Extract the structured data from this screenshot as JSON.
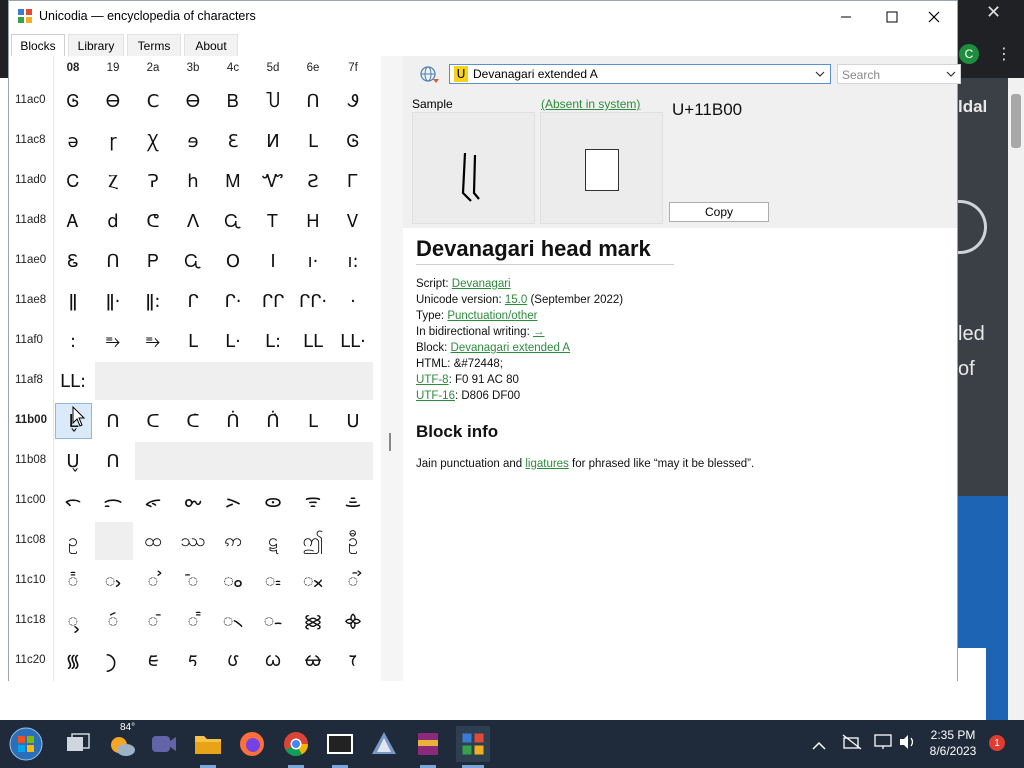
{
  "window": {
    "title": "Unicodia — encyclopedia of characters"
  },
  "tabs": [
    {
      "label": "Blocks",
      "active": true
    },
    {
      "label": "Library",
      "active": false
    },
    {
      "label": "Terms",
      "active": false
    },
    {
      "label": "About",
      "active": false
    }
  ],
  "grid": {
    "columns": [
      "08",
      "19",
      "2a",
      "3b",
      "4c",
      "5d",
      "6e",
      "7f"
    ],
    "rows": [
      {
        "label": "11ac0",
        "chars": [
          "Ꮆ",
          "Ꮎ",
          "Ⅽ",
          "Ꮎ",
          "Ᏼ",
          "Ⴎ",
          "Ո",
          "Ꮽ"
        ]
      },
      {
        "label": "11ac8",
        "chars": [
          "ә",
          "ɼ",
          "Ꭓ",
          "ɘ",
          "Ɛ",
          "И",
          "Ⅼ",
          "Ꮆ"
        ]
      },
      {
        "label": "11ad0",
        "chars": [
          "Ꮯ",
          "Ⲍ",
          "Ɂ",
          "h",
          "Ꮇ",
          "Ꮙ",
          "Ƨ",
          "Ꮁ"
        ]
      },
      {
        "label": "11ad8",
        "chars": [
          "Ꭺ",
          "d",
          "ᕦ",
          "Λ",
          "Ꮹ",
          "Ꭲ",
          "Ꮋ",
          "Ꮩ"
        ]
      },
      {
        "label": "11ae0",
        "chars": [
          "Ꮛ",
          "Ո",
          "Ꮲ",
          "Ꮹ",
          "O",
          "I",
          "ı·",
          "ı:"
        ]
      },
      {
        "label": "11ae8",
        "chars": [
          "ǁ",
          "ǁ·",
          "ǁ:",
          "ᒋ",
          "ᒋ·",
          "ᒋᒋ",
          "ᒋᒋ·",
          "·"
        ]
      },
      {
        "label": "11af0",
        "chars": [
          ":",
          "⥱",
          "⥱",
          "ᒪ",
          "ᒪ·",
          "ᒪ:",
          "ᒪᒪ",
          "ᒪᒪ·"
        ]
      }
    ],
    "row_11af8": {
      "label": "11af8",
      "char": "ᒪᒪ:"
    },
    "row_11b00": {
      "label": "11b00",
      "chars": [
        "ᒪ̬",
        "ᑎ",
        "ᑕ",
        "ᑕ̇",
        "ᑏ",
        "ᑏ̇",
        "ᒪ",
        "ᑌ"
      ]
    },
    "row_11b08": {
      "label": "11b08",
      "chars": [
        "ᑌ̬",
        "ᑎ"
      ]
    },
    "row_11c08": {
      "label": "11c08",
      "chars": [
        "ဥ",
        "ထ",
        "ဿ",
        "ဢ",
        "ဋ",
        "ဤ",
        "ဦ"
      ]
    },
    "rows_tail": [
      {
        "label": "11c00",
        "chars": [
          "ᯞ",
          "ᯟ",
          "ᯠ",
          "ᯡ",
          "ᯢ",
          "ᯣ",
          "ᯤ",
          "ᯥ"
        ]
      },
      {
        "label": "11c10",
        "chars": [
          "᯦",
          "ᯧ",
          "ᯨ",
          "ᯩ",
          "ᯪ",
          "ᯫ",
          "ᯬ",
          "ᯭ"
        ]
      },
      {
        "label": "11c18",
        "chars": [
          "ᯮ",
          "ᯯ",
          "ᯰ",
          "ᯱ",
          "᯲",
          "᯳",
          "᯼",
          "᯽"
        ]
      },
      {
        "label": "11c20",
        "chars": [
          "᯾",
          "᯿",
          "ᰀ",
          "ᰁ",
          "ᰂ",
          "ᰃ",
          "ᰄ",
          "ᰅ"
        ]
      }
    ]
  },
  "controls": {
    "block_dropdown": "Devanagari extended A",
    "block_glyph": "ᑌ",
    "search_placeholder": "Search"
  },
  "sample": {
    "label": "Sample",
    "absent_label": "(Absent in system)",
    "codepoint": "U+11B00",
    "glyph": "ᒪ̬",
    "copy_label": "Copy"
  },
  "details": {
    "title": "Devanagari head mark",
    "script_label": "Script: ",
    "script_value": "Devanagari",
    "version_label": "Unicode version: ",
    "version_value": "15.0",
    "version_suffix": " (September 2022)",
    "type_label": "Type: ",
    "type_value": "Punctuation/other",
    "bidi_label": "In bidirectional writing: ",
    "bidi_value": "→",
    "block_label": "Block: ",
    "block_value": "Devanagari extended A",
    "html_text": "HTML: &#72448;",
    "utf8_label": "UTF-8",
    "utf8_value": ": F0 91 AC 80",
    "utf16_label": "UTF-16",
    "utf16_value": ": D806 DF00",
    "block_info_title": "Block info",
    "block_info_prefix": "Jain punctuation and ",
    "block_info_link": "ligatures",
    "block_info_suffix": " for phrased like “may it be blessed”."
  },
  "background_page": {
    "text_1": "ldal",
    "text_2": "led",
    "text_3": "of",
    "avatar_letter": "C"
  },
  "taskbar": {
    "weather_temp": "84°",
    "time": "2:35 PM",
    "date": "8/6/2023",
    "notification_count": "1"
  },
  "colors": {
    "link_green": "#2e8b3d",
    "selection_blue": "#dbeaf8",
    "taskbar": "#1f2b3a"
  }
}
